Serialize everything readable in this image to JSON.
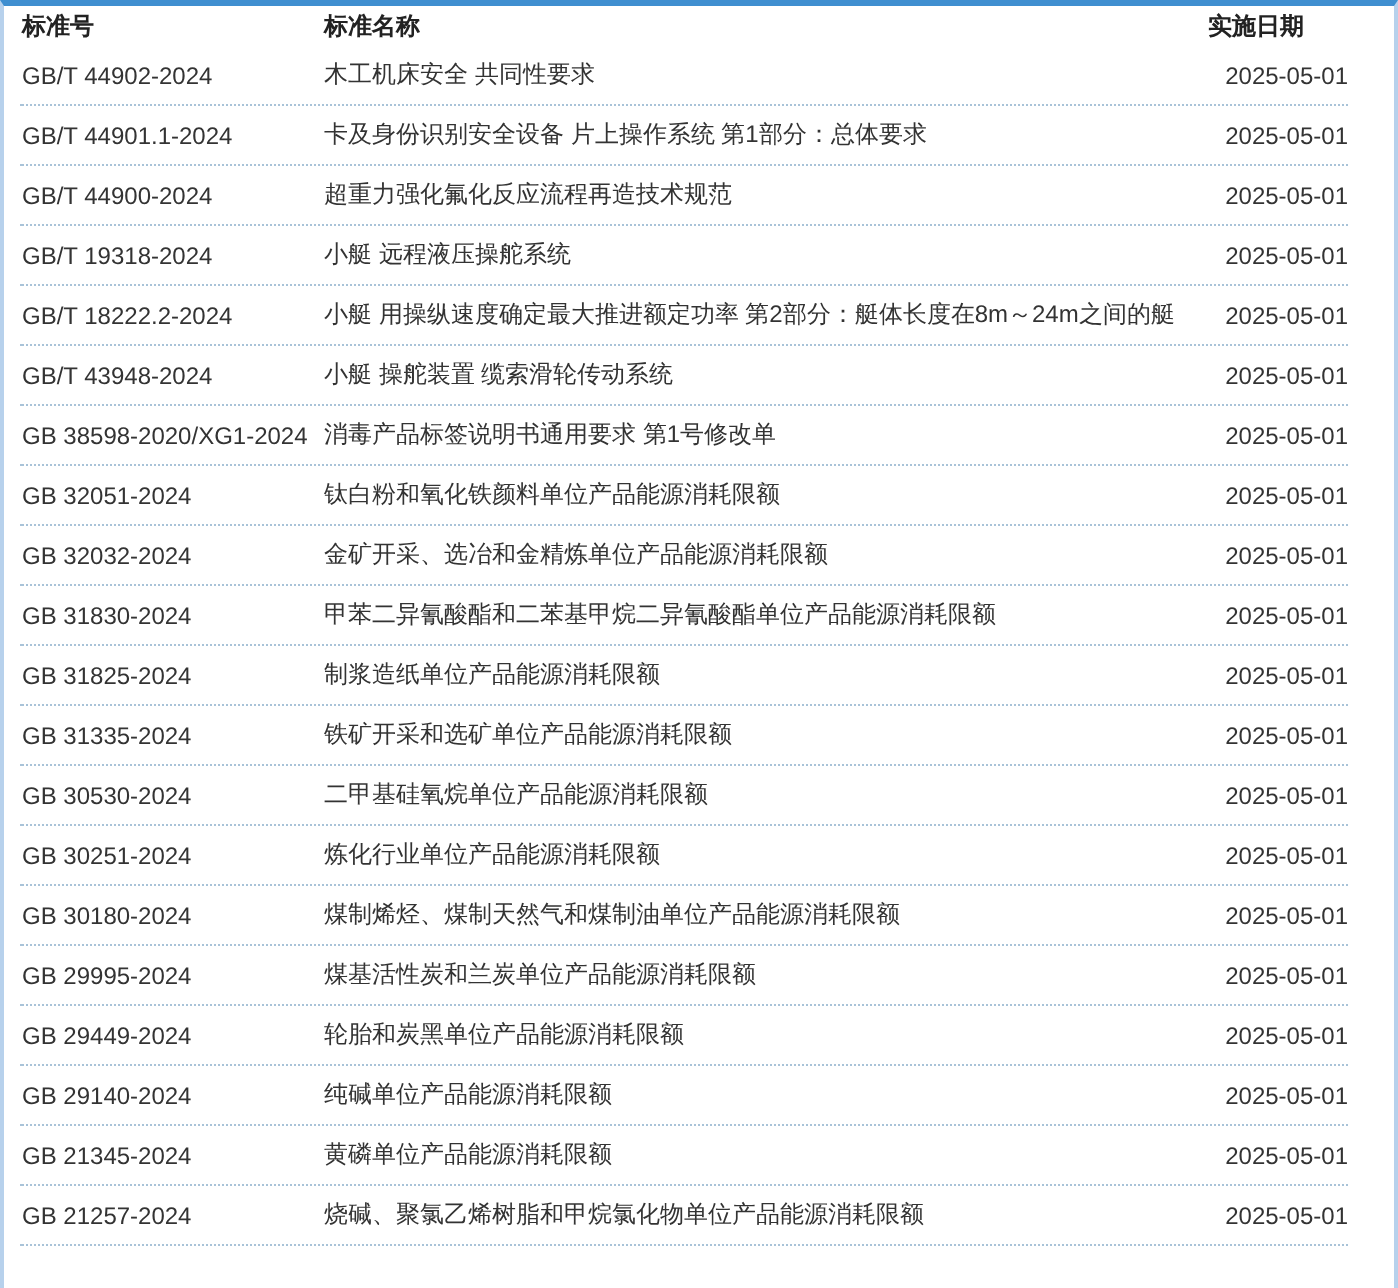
{
  "table": {
    "columns": [
      "标准号",
      "标准名称",
      "实施日期"
    ],
    "rows": [
      {
        "code": "GB/T 44902-2024",
        "name": "木工机床安全 共同性要求",
        "date": "2025-05-01"
      },
      {
        "code": "GB/T 44901.1-2024",
        "name": "卡及身份识别安全设备 片上操作系统 第1部分：总体要求",
        "date": "2025-05-01"
      },
      {
        "code": "GB/T 44900-2024",
        "name": "超重力强化氟化反应流程再造技术规范",
        "date": "2025-05-01"
      },
      {
        "code": "GB/T 19318-2024",
        "name": "小艇 远程液压操舵系统",
        "date": "2025-05-01"
      },
      {
        "code": "GB/T 18222.2-2024",
        "name": "小艇 用操纵速度确定最大推进额定功率 第2部分：艇体长度在8m～24m之间的艇",
        "date": "2025-05-01"
      },
      {
        "code": "GB/T 43948-2024",
        "name": "小艇 操舵装置 缆索滑轮传动系统",
        "date": "2025-05-01"
      },
      {
        "code": "GB 38598-2020/XG1-2024",
        "name": "消毒产品标签说明书通用要求 第1号修改单",
        "date": "2025-05-01"
      },
      {
        "code": "GB 32051-2024",
        "name": "钛白粉和氧化铁颜料单位产品能源消耗限额",
        "date": "2025-05-01"
      },
      {
        "code": "GB 32032-2024",
        "name": "金矿开采、选冶和金精炼单位产品能源消耗限额",
        "date": "2025-05-01"
      },
      {
        "code": "GB 31830-2024",
        "name": "甲苯二异氰酸酯和二苯基甲烷二异氰酸酯单位产品能源消耗限额",
        "date": "2025-05-01"
      },
      {
        "code": "GB 31825-2024",
        "name": "制浆造纸单位产品能源消耗限额",
        "date": "2025-05-01"
      },
      {
        "code": "GB 31335-2024",
        "name": "铁矿开采和选矿单位产品能源消耗限额",
        "date": "2025-05-01"
      },
      {
        "code": "GB 30530-2024",
        "name": "二甲基硅氧烷单位产品能源消耗限额",
        "date": "2025-05-01"
      },
      {
        "code": "GB 30251-2024",
        "name": "炼化行业单位产品能源消耗限额",
        "date": "2025-05-01"
      },
      {
        "code": "GB 30180-2024",
        "name": "煤制烯烃、煤制天然气和煤制油单位产品能源消耗限额",
        "date": "2025-05-01"
      },
      {
        "code": "GB 29995-2024",
        "name": "煤基活性炭和兰炭单位产品能源消耗限额",
        "date": "2025-05-01"
      },
      {
        "code": "GB 29449-2024",
        "name": "轮胎和炭黑单位产品能源消耗限额",
        "date": "2025-05-01"
      },
      {
        "code": "GB 29140-2024",
        "name": "纯碱单位产品能源消耗限额",
        "date": "2025-05-01"
      },
      {
        "code": "GB 21345-2024",
        "name": "黄磷单位产品能源消耗限额",
        "date": "2025-05-01"
      },
      {
        "code": "GB 21257-2024",
        "name": "烧碱、聚氯乙烯树脂和甲烷氯化物单位产品能源消耗限额",
        "date": "2025-05-01"
      }
    ]
  }
}
